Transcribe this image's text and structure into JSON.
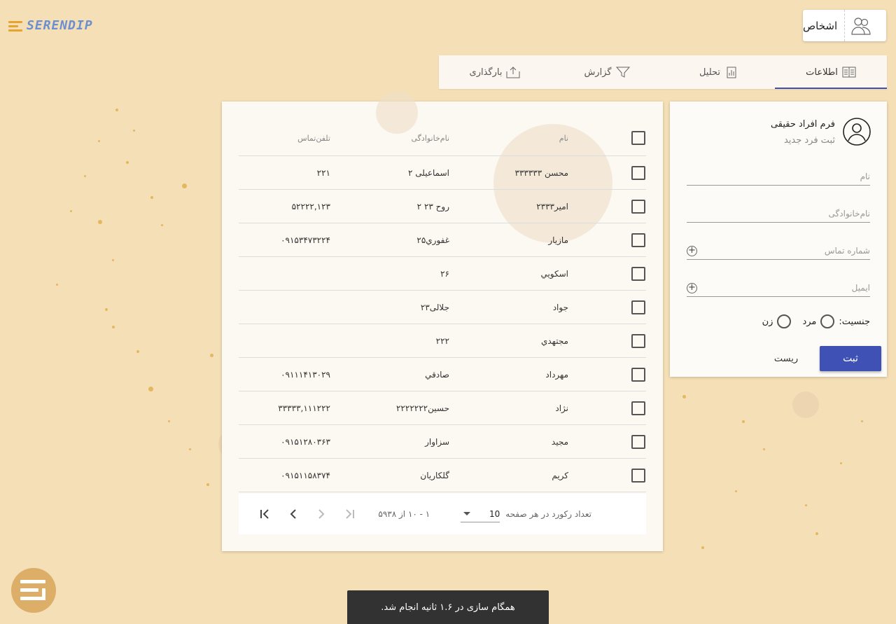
{
  "logo": {
    "text": "SERENDIP"
  },
  "persons": {
    "label": "اشخاص"
  },
  "tabs": [
    {
      "label": "اطلاعات",
      "icon": "info-table-icon",
      "active": true
    },
    {
      "label": "تحلیل",
      "icon": "analysis-chart-icon",
      "active": false
    },
    {
      "label": "گزارش",
      "icon": "filter-icon",
      "active": false
    },
    {
      "label": "بارگذاری",
      "icon": "upload-icon",
      "active": false
    }
  ],
  "form": {
    "title": "فرم افراد حقیقی",
    "subtitle": "ثبت فرد جدید",
    "name_placeholder": "نام",
    "family_placeholder": "نام‌خانوادگی",
    "phone_placeholder": "شماره تماس",
    "email_placeholder": "ایمیل",
    "gender_label": "جنسیت:",
    "gender_male": "مرد",
    "gender_female": "زن",
    "save_label": "ثبت",
    "reset_label": "ریست"
  },
  "table": {
    "headers": {
      "name": "نام",
      "family": "نام‌خانوادگی",
      "phone": "تلفن‌تماس"
    },
    "rows": [
      {
        "name": "محسن ۳۳۳۳۳۳",
        "family": "اسماعیلی ۲",
        "phone": "۲۲۱"
      },
      {
        "name": "امیر۲۳۳۳",
        "family": "روح ۲۳ ۲",
        "phone": "۵۲۲۲۲,۱۲۳"
      },
      {
        "name": "مازیار",
        "family": "غفوري۲۵",
        "phone": "۰۹۱۵۳۴۷۳۲۲۴"
      },
      {
        "name": "اسكويي",
        "family": "۲۶",
        "phone": ""
      },
      {
        "name": "جواد",
        "family": "جلالی۲۳",
        "phone": ""
      },
      {
        "name": "مجتهدي",
        "family": "۲۲۲",
        "phone": ""
      },
      {
        "name": "مهرداد",
        "family": "صادقي",
        "phone": "۰۹۱۱۱۴۱۳۰۲۹"
      },
      {
        "name": "نژاد",
        "family": "حسین۲۲۲۲۲۲۲",
        "phone": "۳۳۳۳۳,۱۱۱۲۲۲"
      },
      {
        "name": "مجید",
        "family": "سزاوار",
        "phone": "۰۹۱۵۱۲۸۰۳۶۳"
      },
      {
        "name": "کریم",
        "family": "گلکاریان",
        "phone": "۰۹۱۵۱۱۵۸۳۷۴"
      }
    ],
    "paginator": {
      "rows_per_page_label": "تعداد رکورد در هر صفحه",
      "rows_per_page_value": "10",
      "range_label": "۱ - ۱۰ از ۵۹۳۸"
    }
  },
  "snackbar": {
    "text": "همگام سازی در ۱.۶ ثانیه انجام شد."
  },
  "colors": {
    "background": "#f4dfb6",
    "primary": "#3f51b5",
    "accent": "#e8a22e",
    "fab": "#dcae68"
  }
}
